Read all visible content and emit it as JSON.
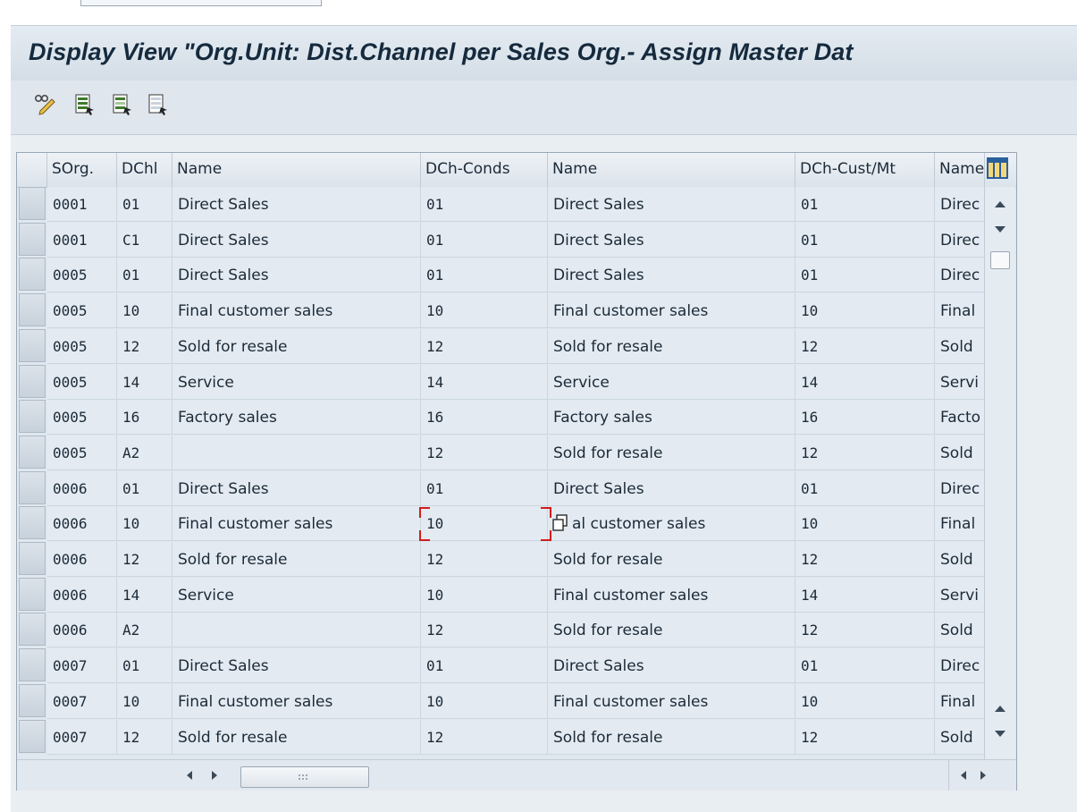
{
  "window": {
    "title": "Display View \"Org.Unit: Dist.Channel per Sales Org.- Assign Master Dat"
  },
  "toolbar": {
    "buttons": [
      {
        "icon": "pencil-glasses-icon",
        "tooltip": "Display/Change"
      },
      {
        "icon": "select-all-icon",
        "tooltip": "Select All"
      },
      {
        "icon": "select-block-icon",
        "tooltip": "Select Block"
      },
      {
        "icon": "deselect-all-icon",
        "tooltip": "Deselect All"
      }
    ]
  },
  "table": {
    "columns": [
      "SOrg.",
      "DChl",
      "Name",
      "DCh-Conds",
      "Name",
      "DCh-Cust/Mt",
      "Name"
    ],
    "rows": [
      [
        "0001",
        "01",
        "Direct Sales",
        "01",
        "Direct Sales",
        "01",
        "Direc"
      ],
      [
        "0001",
        "C1",
        "Direct Sales",
        "01",
        "Direct Sales",
        "01",
        "Direc"
      ],
      [
        "0005",
        "01",
        "Direct Sales",
        "01",
        "Direct Sales",
        "01",
        "Direc"
      ],
      [
        "0005",
        "10",
        "Final customer sales",
        "10",
        "Final customer sales",
        "10",
        "Final"
      ],
      [
        "0005",
        "12",
        "Sold for resale",
        "12",
        "Sold for resale",
        "12",
        "Sold"
      ],
      [
        "0005",
        "14",
        "Service",
        "14",
        "Service",
        "14",
        "Servi"
      ],
      [
        "0005",
        "16",
        "Factory sales",
        "16",
        "Factory sales",
        "16",
        "Facto"
      ],
      [
        "0005",
        "A2",
        "",
        "12",
        "Sold for resale",
        "12",
        "Sold"
      ],
      [
        "0006",
        "01",
        "Direct Sales",
        "01",
        "Direct Sales",
        "01",
        "Direc"
      ],
      [
        "0006",
        "10",
        "Final customer sales",
        "10",
        "al customer sales",
        "10",
        "Final"
      ],
      [
        "0006",
        "12",
        "Sold for resale",
        "12",
        "Sold for resale",
        "12",
        "Sold"
      ],
      [
        "0006",
        "14",
        "Service",
        "10",
        "Final customer sales",
        "14",
        "Servi"
      ],
      [
        "0006",
        "A2",
        "",
        "12",
        "Sold for resale",
        "12",
        "Sold"
      ],
      [
        "0007",
        "01",
        "Direct Sales",
        "01",
        "Direct Sales",
        "01",
        "Direc"
      ],
      [
        "0007",
        "10",
        "Final customer sales",
        "10",
        "Final customer sales",
        "10",
        "Final"
      ],
      [
        "0007",
        "12",
        "Sold for resale",
        "12",
        "Sold for resale",
        "12",
        "Sold"
      ]
    ]
  },
  "colors": {
    "title_text": "#152a3d",
    "focus_marker": "#d21c1c",
    "toolbar_icon": "#3f7a2c"
  }
}
